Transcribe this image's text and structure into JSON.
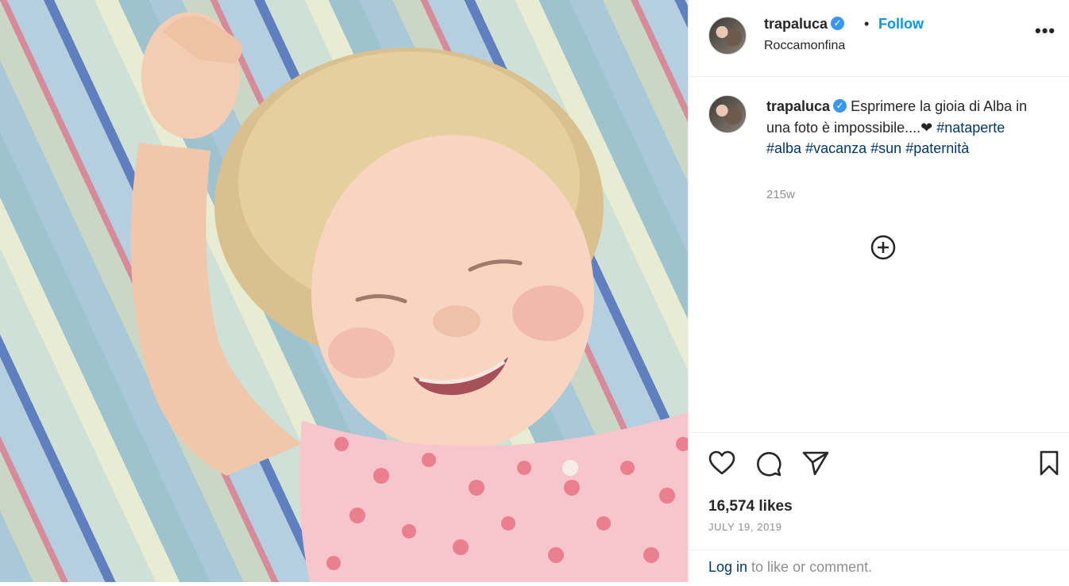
{
  "post": {
    "username": "trapaluca",
    "follow_label": "Follow",
    "separator": "•",
    "location": "Roccamonfina",
    "more_label": "•••",
    "verified_mark": "✓"
  },
  "caption": {
    "username": "trapaluca",
    "text": "Esprimere la gioia di Alba in una foto è impossibile....❤",
    "hashtags": [
      "#nataperte",
      "#alba",
      "#vacanza",
      "#sun",
      "#paternità"
    ],
    "age": "215w"
  },
  "engagement": {
    "likes": "16,574 likes",
    "date": "JULY 19, 2019"
  },
  "login": {
    "link": "Log in",
    "rest": " to like or comment."
  },
  "icons": {
    "like": "heart-icon",
    "comment": "comment-bubble-icon",
    "share": "paper-plane-icon",
    "save": "bookmark-icon",
    "load_more": "plus-circle-icon"
  },
  "colors": {
    "follow": "#0095f6",
    "hashtag": "#00376b",
    "muted": "#8e8e8e",
    "verified": "#3897f0"
  }
}
